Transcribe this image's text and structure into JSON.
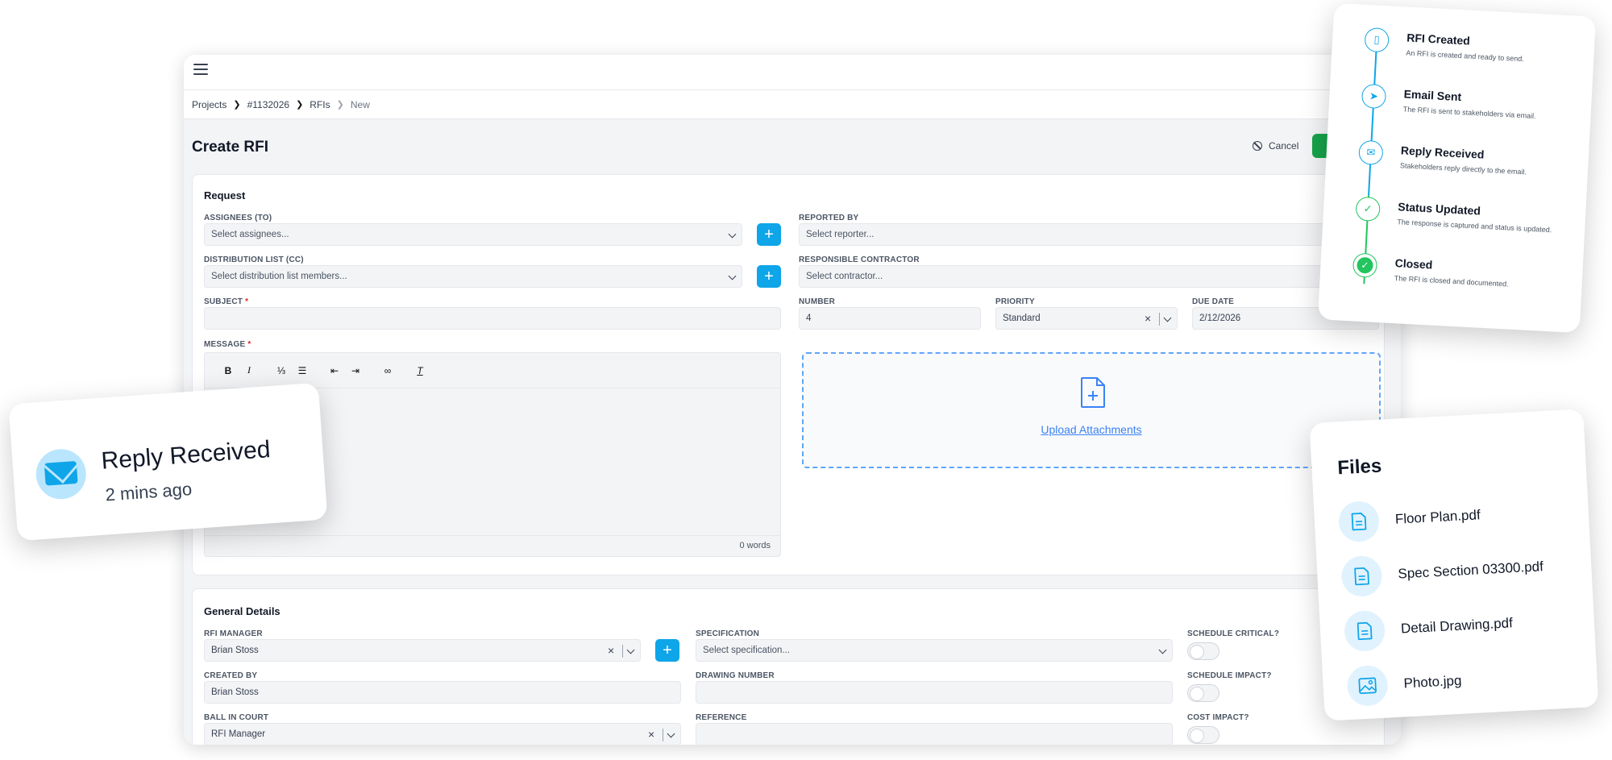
{
  "breadcrumb": {
    "projects": "Projects",
    "project_id": "#1132026",
    "rfis": "RFIs",
    "current": "New"
  },
  "header": {
    "title": "Create RFI",
    "cancel_label": "Cancel"
  },
  "request": {
    "title": "Request",
    "assignees_label": "ASSIGNEES (TO)",
    "assignees_placeholder": "Select assignees...",
    "reported_by_label": "REPORTED BY",
    "reported_by_placeholder": "Select reporter...",
    "distribution_label": "DISTRIBUTION LIST (CC)",
    "distribution_placeholder": "Select distribution list members...",
    "contractor_label": "RESPONSIBLE CONTRACTOR",
    "contractor_placeholder": "Select contractor...",
    "subject_label": "SUBJECT",
    "number_label": "NUMBER",
    "number_value": "4",
    "priority_label": "PRIORITY",
    "priority_value": "Standard",
    "due_date_label": "DUE DATE",
    "due_date_value": "2/12/2026",
    "message_label": "MESSAGE",
    "word_count": "0 words",
    "upload_label": "Upload Attachments",
    "required_mark": "*",
    "plus": "+"
  },
  "general": {
    "title": "General Details",
    "rfi_manager_label": "RFI MANAGER",
    "rfi_manager_value": "Brian Stoss",
    "specification_label": "SPECIFICATION",
    "specification_placeholder": "Select specification...",
    "schedule_critical_label": "SCHEDULE CRITICAL?",
    "created_by_label": "CREATED BY",
    "created_by_value": "Brian Stoss",
    "drawing_number_label": "DRAWING NUMBER",
    "schedule_impact_label": "SCHEDULE IMPACT?",
    "ball_in_court_label": "BALL IN COURT",
    "ball_in_court_value": "RFI Manager",
    "reference_label": "REFERENCE",
    "cost_impact_label": "COST IMPACT?"
  },
  "notification": {
    "title": "Reply Received",
    "time": "2 mins ago"
  },
  "timeline": [
    {
      "title": "RFI Created",
      "desc": "An RFI is created and ready to send.",
      "icon": "document-icon"
    },
    {
      "title": "Email Sent",
      "desc": "The RFI is sent to stakeholders via email.",
      "icon": "send-icon"
    },
    {
      "title": "Reply Received",
      "desc": "Stakeholders reply directly to the email.",
      "icon": "mail-icon"
    },
    {
      "title": "Status Updated",
      "desc": "The response is captured and status is updated.",
      "icon": "check-icon"
    },
    {
      "title": "Closed",
      "desc": "The RFI is closed and documented.",
      "icon": "check-circle-icon"
    }
  ],
  "files": {
    "title": "Files",
    "items": [
      "Floor Plan.pdf",
      "Spec Section 03300.pdf",
      "Detail Drawing.pdf",
      "Photo.jpg"
    ]
  },
  "colors": {
    "accent": "#0ea5e9",
    "save": "#16a34a",
    "link": "#3b82f6",
    "timeline_blue": "#0ea5e9",
    "timeline_green": "#22c55e"
  }
}
